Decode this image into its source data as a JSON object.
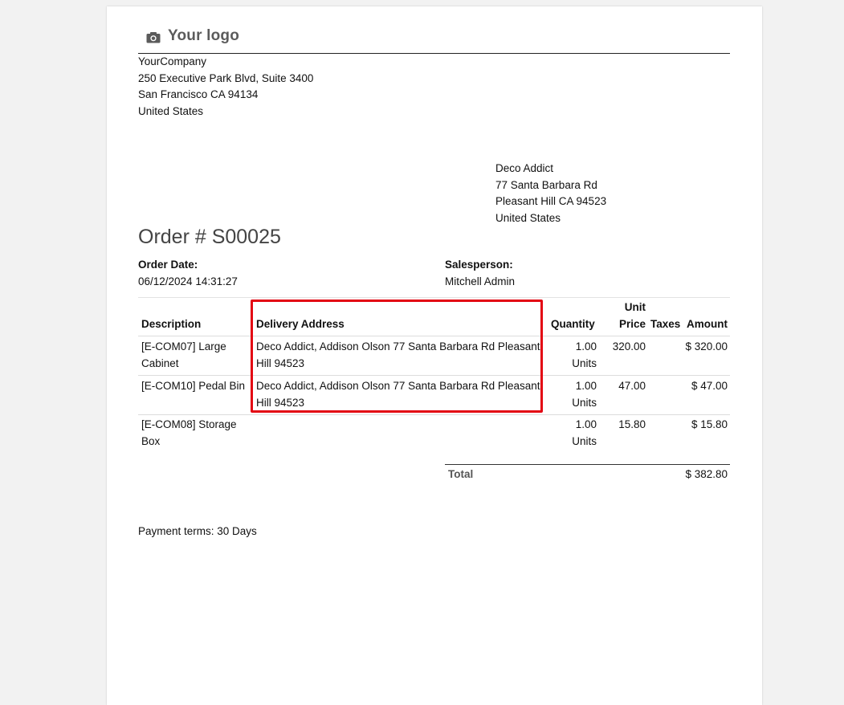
{
  "header": {
    "logo_text": "Your logo",
    "logo_icon": "camera-icon"
  },
  "company": {
    "name": "YourCompany",
    "street": "250 Executive Park Blvd, Suite 3400",
    "city_line": "San Francisco CA 94134",
    "country": "United States"
  },
  "customer": {
    "name": "Deco Addict",
    "street": "77 Santa Barbara Rd",
    "city_line": "Pleasant Hill CA 94523",
    "country": "United States"
  },
  "order": {
    "title": "Order # S00025",
    "date_label": "Order Date:",
    "date_value": "06/12/2024 14:31:27",
    "salesperson_label": "Salesperson:",
    "salesperson_value": "Mitchell Admin"
  },
  "table": {
    "headers": {
      "description": "Description",
      "delivery_address": "Delivery Address",
      "quantity": "Quantity",
      "unit_price_line1": "Unit",
      "unit_price_line2": "Price",
      "taxes": "Taxes",
      "amount": "Amount"
    },
    "rows": [
      {
        "description_line1": "[E-COM07] Large",
        "description_line2": "Cabinet",
        "delivery_line1": "Deco Addict, Addison Olson 77 Santa Barbara Rd Pleasant",
        "delivery_line2": "Hill 94523",
        "qty": "1.00",
        "uom": "Units",
        "unit_price": "320.00",
        "taxes": "",
        "amount": "$ 320.00"
      },
      {
        "description_line1": "[E-COM10] Pedal Bin",
        "description_line2": "",
        "delivery_line1": "Deco Addict, Addison Olson 77 Santa Barbara Rd Pleasant",
        "delivery_line2": "Hill 94523",
        "qty": "1.00",
        "uom": "Units",
        "unit_price": "47.00",
        "taxes": "",
        "amount": "$ 47.00"
      },
      {
        "description_line1": "[E-COM08] Storage",
        "description_line2": "Box",
        "delivery_line1": "",
        "delivery_line2": "",
        "qty": "1.00",
        "uom": "Units",
        "unit_price": "15.80",
        "taxes": "",
        "amount": "$ 15.80"
      }
    ]
  },
  "totals": {
    "label": "Total",
    "value": "$ 382.80"
  },
  "footer": {
    "payment_terms": "Payment terms: 30 Days"
  },
  "colors": {
    "highlight": "#e30613",
    "page_background": "#f2f2f2",
    "sheet_background": "#ffffff"
  }
}
